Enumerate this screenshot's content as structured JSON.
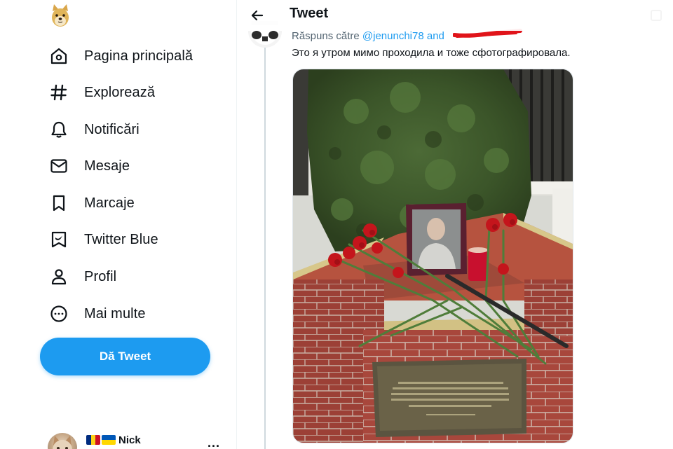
{
  "sidebar": {
    "logo": "doge-logo",
    "items": [
      {
        "label": "Pagina principală",
        "icon": "home-icon"
      },
      {
        "label": "Explorează",
        "icon": "hashtag-icon"
      },
      {
        "label": "Notificări",
        "icon": "bell-icon"
      },
      {
        "label": "Mesaje",
        "icon": "envelope-icon"
      },
      {
        "label": "Marcaje",
        "icon": "bookmark-icon"
      },
      {
        "label": "Twitter Blue",
        "icon": "twitter-blue-icon"
      },
      {
        "label": "Profil",
        "icon": "person-icon"
      },
      {
        "label": "Mai multe",
        "icon": "more-circle-icon"
      }
    ],
    "tweet_button": "Dă Tweet"
  },
  "account": {
    "name": "Nick",
    "flags": [
      "ro-flag",
      "ua-flag"
    ],
    "more": "..."
  },
  "header": {
    "title": "Tweet"
  },
  "reply": {
    "prefix": "Răspuns către",
    "mention": "@jenunchi78",
    "conjunction": "and"
  },
  "tweet": {
    "text": "Это я утром мимо проходила и тоже сфотографировала."
  },
  "colors": {
    "accent": "#1d9bf0",
    "text": "#0f1419",
    "secondary": "#536471",
    "redaction": "#e0141a"
  }
}
